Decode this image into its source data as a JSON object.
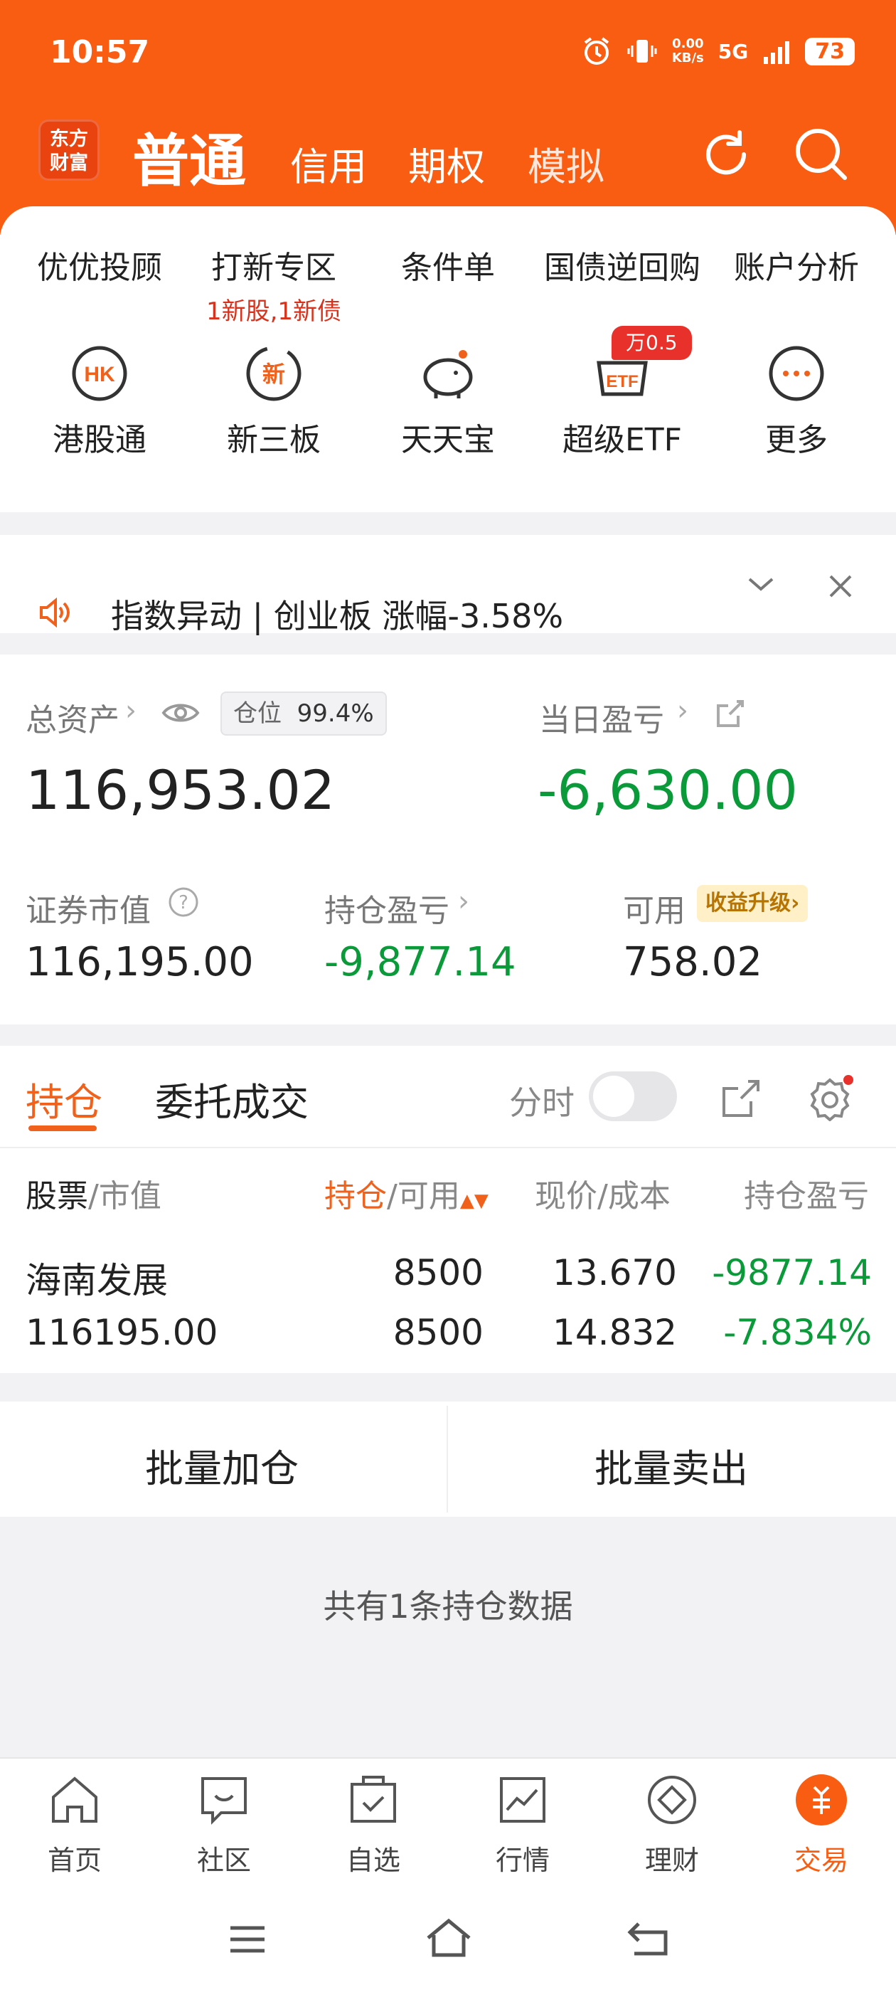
{
  "status": {
    "time": "10:57",
    "net_speed": "0.00",
    "net_unit": "KB/s",
    "signal": "5G",
    "battery": "73"
  },
  "header": {
    "logo_line1": "东方",
    "logo_line2": "财富",
    "tab_active": "普通",
    "tabs": [
      "信用",
      "期权",
      "模拟"
    ]
  },
  "menu": {
    "row1": [
      {
        "label": "优优投顾",
        "sub": ""
      },
      {
        "label": "打新专区",
        "sub": "1新股,1新债"
      },
      {
        "label": "条件单",
        "sub": ""
      },
      {
        "label": "国债逆回购",
        "sub": ""
      },
      {
        "label": "账户分析",
        "sub": ""
      }
    ],
    "row2": [
      {
        "label": "港股通",
        "icon_text": "HK"
      },
      {
        "label": "新三板",
        "icon_text": "新"
      },
      {
        "label": "天天宝",
        "icon_text": ""
      },
      {
        "label": "超级ETF",
        "icon_text": "ETF",
        "badge": "万0.5"
      },
      {
        "label": "更多",
        "icon_text": "···"
      }
    ]
  },
  "notice": {
    "text": "指数异动 | 创业板 涨幅-3.58%"
  },
  "assets": {
    "total_label": "总资产",
    "position_label": "仓位",
    "position_value": "99.4%",
    "total_value": "116,953.02",
    "daily_pl_label": "当日盈亏",
    "daily_pl_value": "-6,630.00",
    "market_value_label": "证券市值",
    "market_value": "116,195.00",
    "holding_pl_label": "持仓盈亏",
    "holding_pl": "-9,877.14",
    "available_label": "可用",
    "available_value": "758.02",
    "upgrade_label": "收益升级"
  },
  "holdings": {
    "tab_active": "持仓",
    "tab_other": "委托成交",
    "toggle_label": "分时",
    "headers": {
      "col1a": "股票",
      "col1b": "/市值",
      "col2a": "持仓",
      "col2b": "/可用",
      "col3": "现价/成本",
      "col4": "持仓盈亏"
    },
    "rows": [
      {
        "name": "海南发展",
        "market_value": "116195.00",
        "position": "8500",
        "available": "8500",
        "price": "13.670",
        "cost": "14.832",
        "pl": "-9877.14",
        "pl_pct": "-7.834%"
      }
    ]
  },
  "batch": {
    "add": "批量加仓",
    "sell": "批量卖出"
  },
  "footer_note": "共有1条持仓数据",
  "nav": [
    "首页",
    "社区",
    "自选",
    "行情",
    "理财",
    "交易"
  ],
  "colors": {
    "brand": "#f95d12",
    "loss": "#0a9a3a",
    "alert": "#d9321c"
  }
}
